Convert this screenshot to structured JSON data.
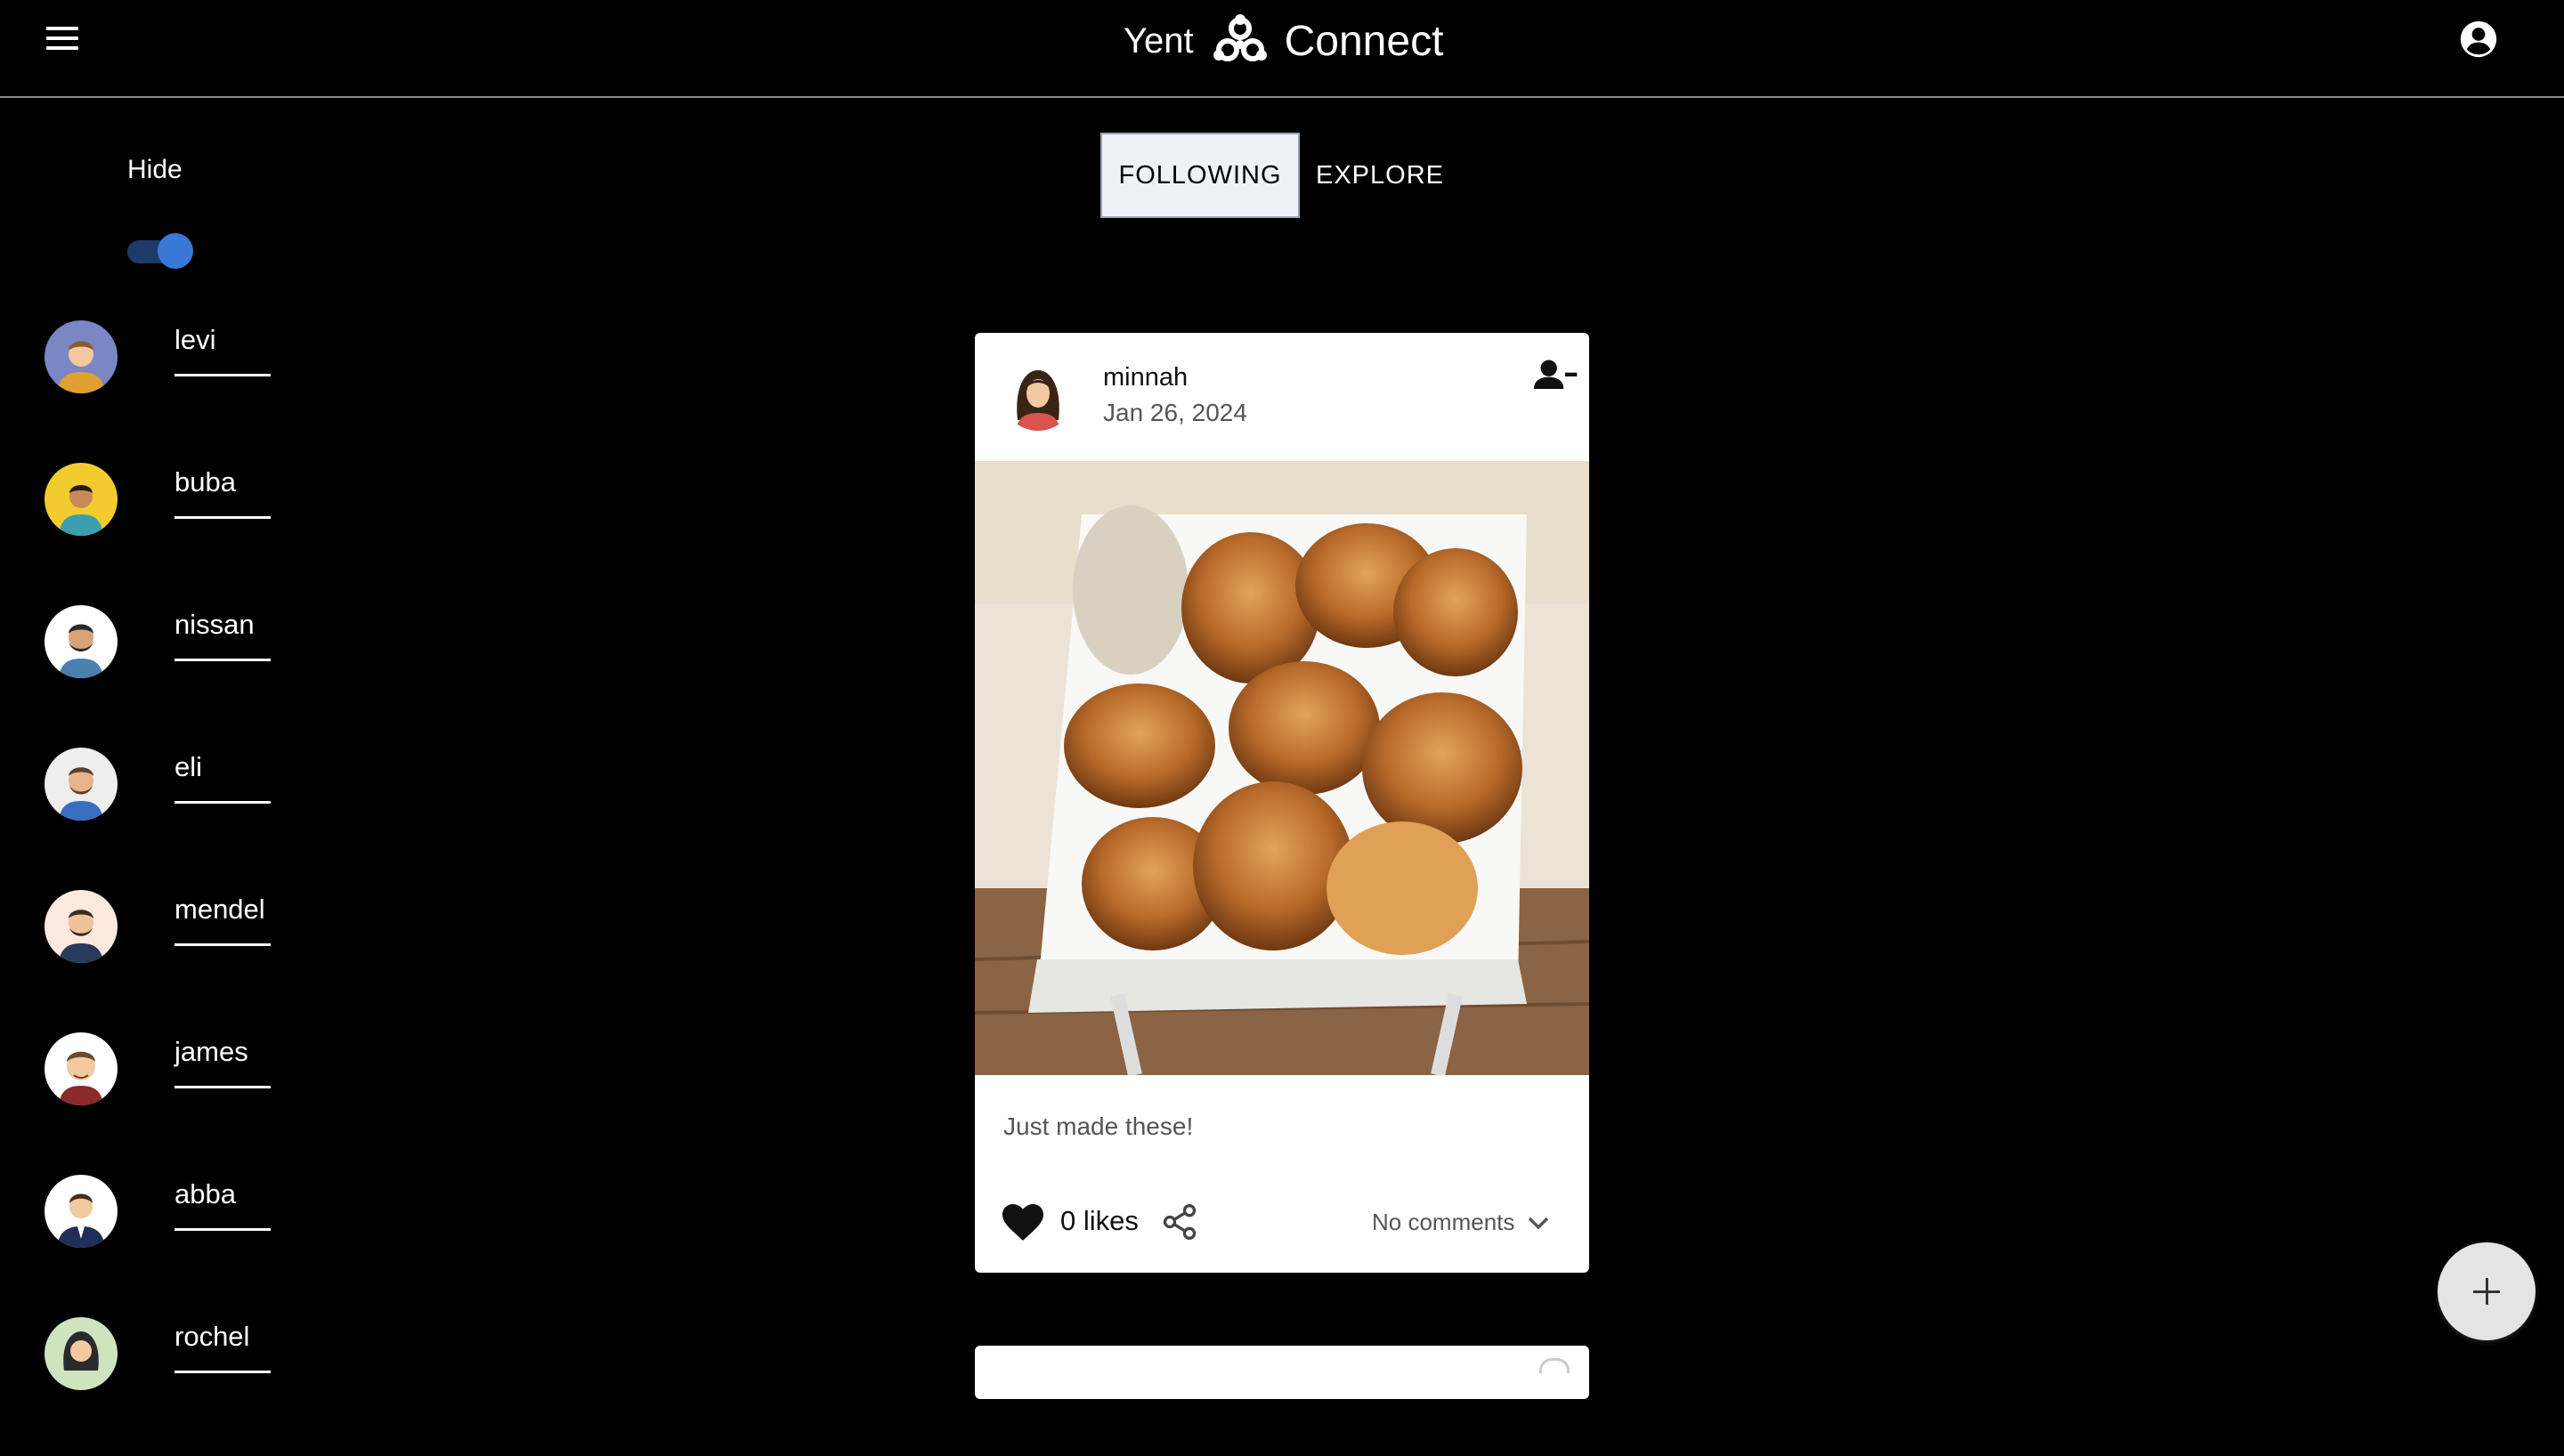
{
  "header": {
    "brand_left": "Yent",
    "brand_right": "Connect",
    "menu_icon": "hamburger-menu-icon",
    "account_icon": "account-circle-icon"
  },
  "sidebar": {
    "hide_label": "Hide",
    "hide_toggle_on": true,
    "users": [
      {
        "name": "levi",
        "avatar_bg": "#7b86c4"
      },
      {
        "name": "buba",
        "avatar_bg": "#f2cc2e"
      },
      {
        "name": "nissan",
        "avatar_bg": "#ffffff"
      },
      {
        "name": "eli",
        "avatar_bg": "#eeeeee"
      },
      {
        "name": "mendel",
        "avatar_bg": "#fbe9df"
      },
      {
        "name": "james",
        "avatar_bg": "#ffffff"
      },
      {
        "name": "abba",
        "avatar_bg": "#ffffff"
      },
      {
        "name": "rochel",
        "avatar_bg": "#cfe3bf"
      }
    ]
  },
  "tabs": {
    "following": "FOLLOWING",
    "explore": "EXPLORE",
    "active": "following"
  },
  "post": {
    "author": "minnah",
    "date": "Jan 26, 2024",
    "caption": "Just made these!",
    "likes": "0 likes",
    "comments": "No comments",
    "unfollow_icon": "person-remove-icon",
    "like_icon": "heart-icon",
    "share_icon": "share-icon"
  },
  "fab": {
    "icon": "plus-icon"
  },
  "colors": {
    "background": "#000000",
    "toggle_thumb": "#3a78d8",
    "toggle_track": "#1e3a66",
    "tab_active_bg": "#eef1f5",
    "card_bg": "#ffffff"
  }
}
